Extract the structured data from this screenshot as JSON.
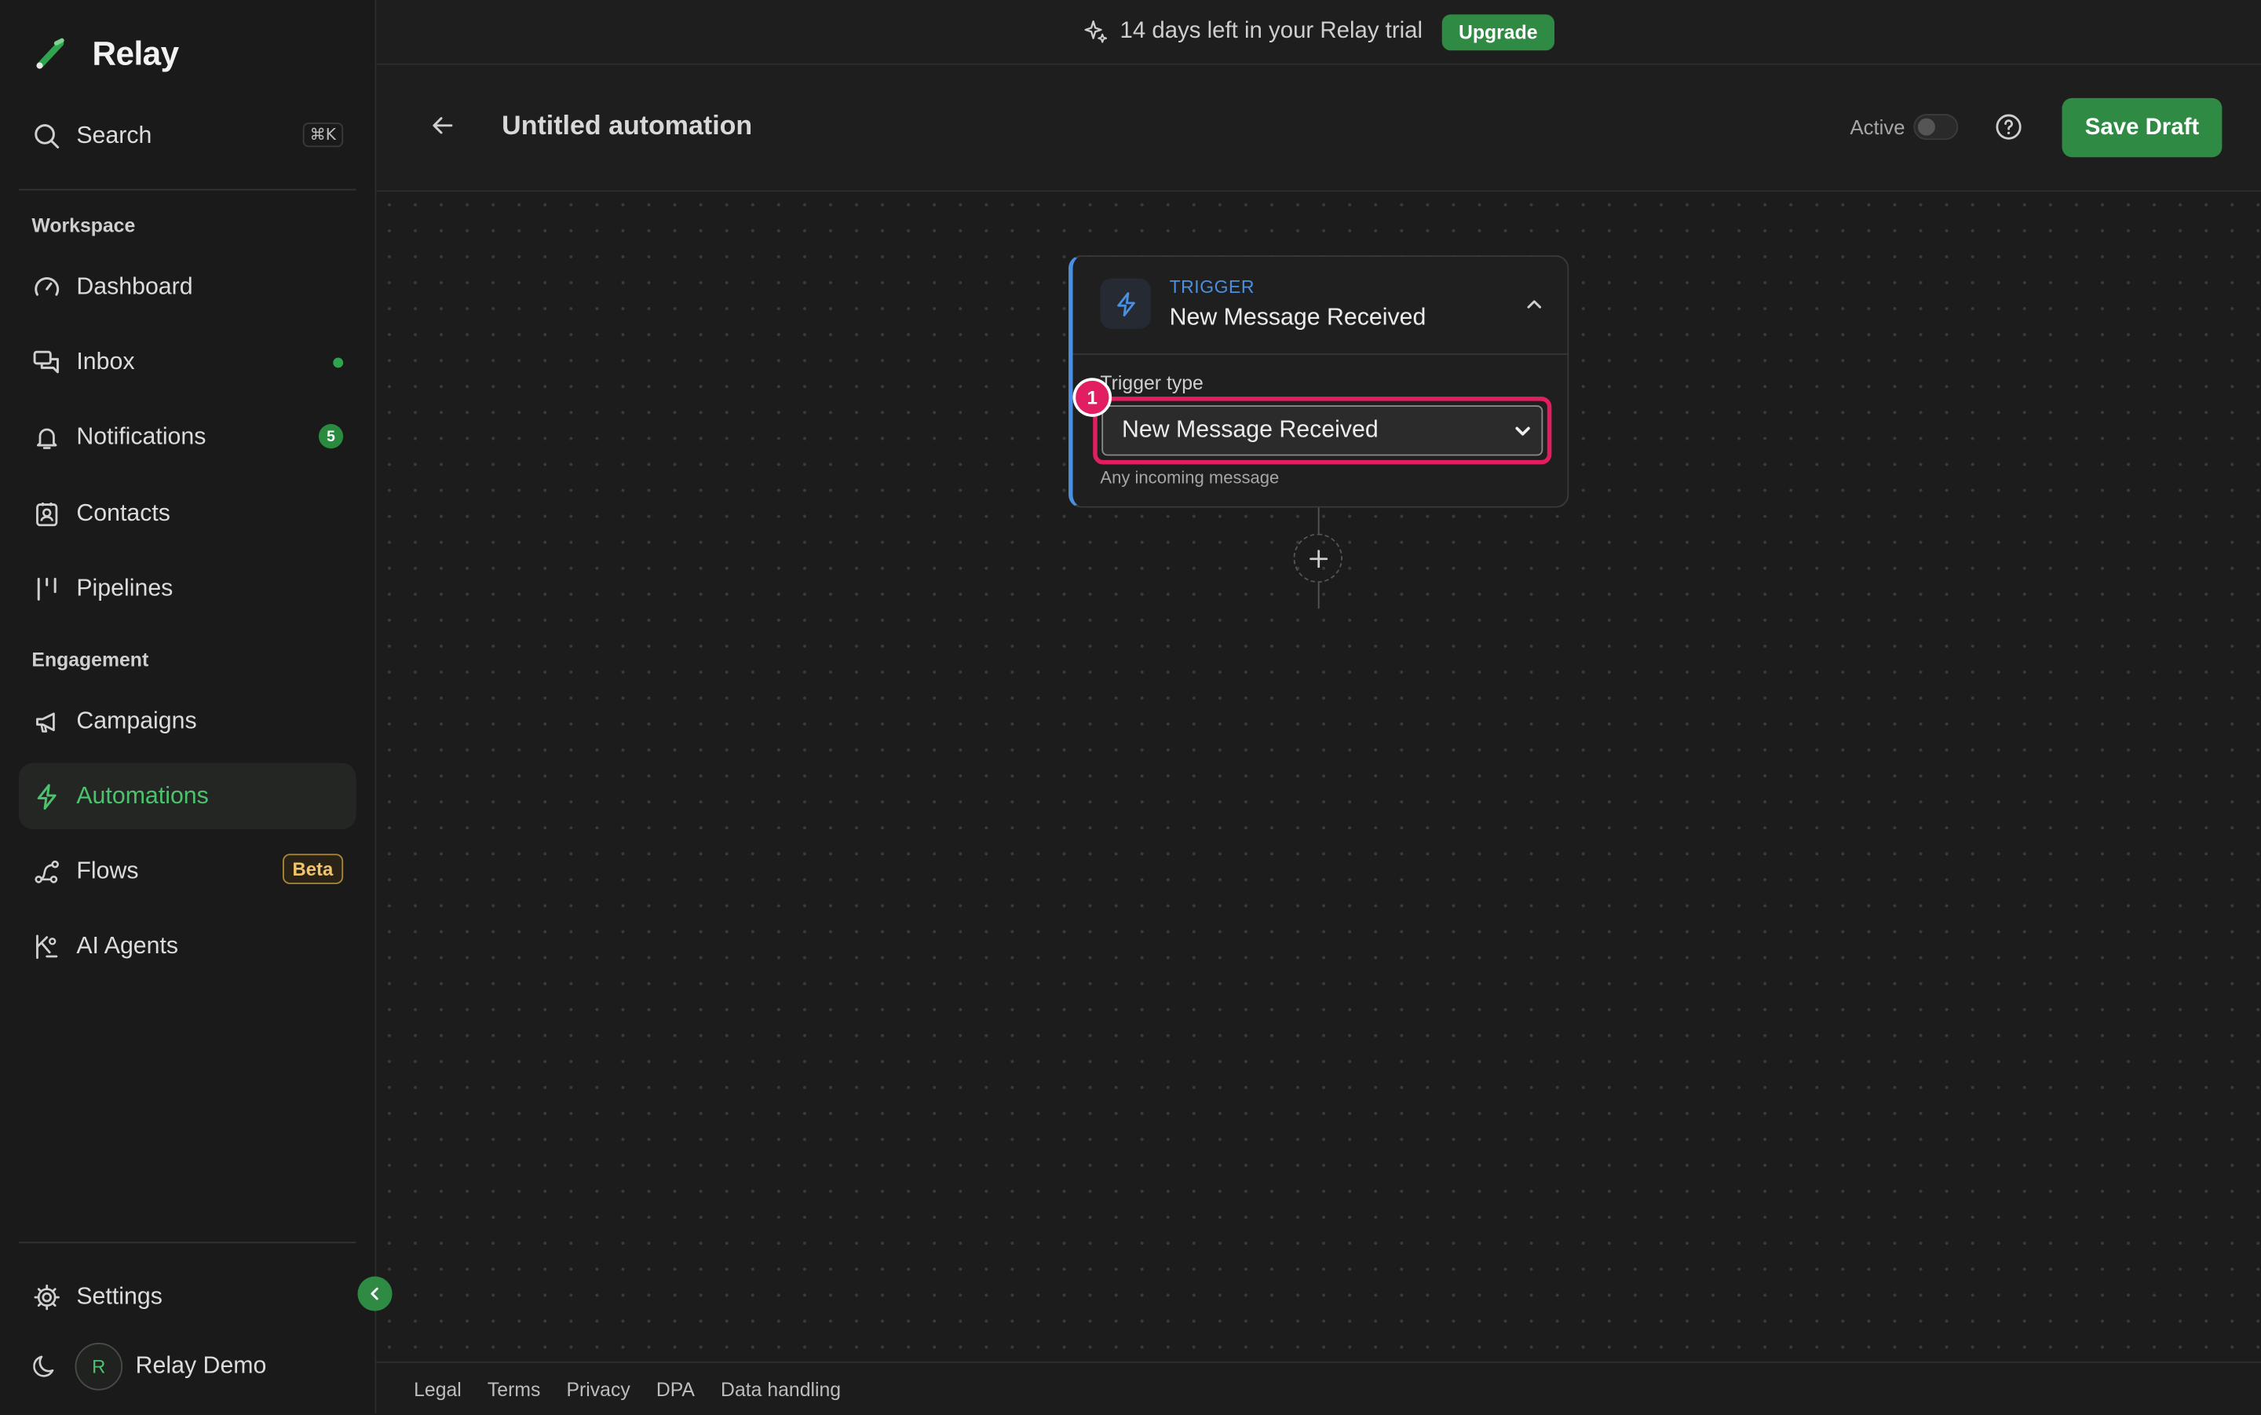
{
  "brand": {
    "name": "Relay",
    "accent": "#2ea44f"
  },
  "sidebar": {
    "search": {
      "label": "Search",
      "shortcut": "⌘K"
    },
    "sections": {
      "workspace": "Workspace",
      "engagement": "Engagement"
    },
    "items": {
      "dashboard": "Dashboard",
      "inbox": "Inbox",
      "notifications": "Notifications",
      "notifications_count": "5",
      "contacts": "Contacts",
      "pipelines": "Pipelines",
      "campaigns": "Campaigns",
      "automations": "Automations",
      "flows": "Flows",
      "flows_badge": "Beta",
      "ai_agents": "AI Agents"
    },
    "active_item": "automations",
    "settings": "Settings",
    "user": {
      "initial": "R",
      "name": "Relay Demo"
    }
  },
  "banner": {
    "text": "14 days left in your Relay trial",
    "cta": "Upgrade"
  },
  "header": {
    "title": "Untitled automation",
    "active_label": "Active",
    "active": false,
    "save_label": "Save Draft"
  },
  "trigger_card": {
    "kicker": "TRIGGER",
    "name": "New Message Received",
    "field_label": "Trigger type",
    "selected": "New Message Received",
    "hint": "Any incoming message",
    "marker": "1",
    "accent": "#4a8fe0",
    "highlight": "#e21e63"
  },
  "footer": {
    "links": [
      "Legal",
      "Terms",
      "Privacy",
      "DPA",
      "Data handling"
    ]
  }
}
